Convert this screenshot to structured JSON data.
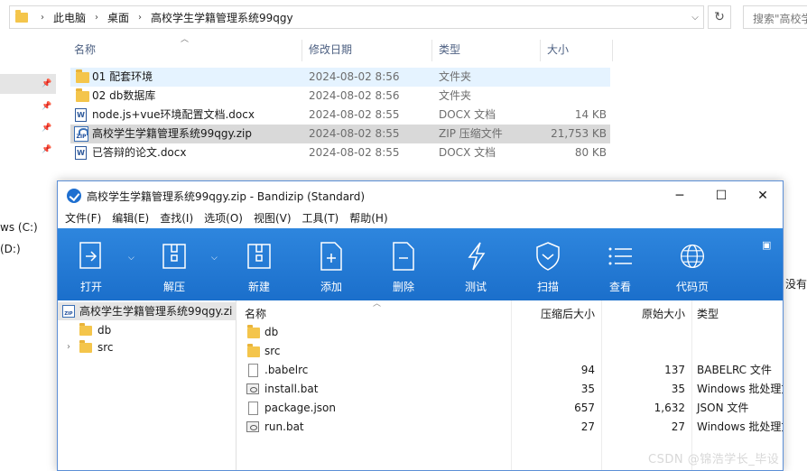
{
  "explorer": {
    "breadcrumb": [
      "此电脑",
      "桌面",
      "高校学生学籍管理系统99qgy"
    ],
    "search_placeholder": "搜索\"高校学",
    "columns": {
      "name": "名称",
      "modified": "修改日期",
      "type": "类型",
      "size": "大小"
    },
    "files": [
      {
        "name": "01  配套环境",
        "modified": "2024-08-02 8:56",
        "type": "文件夹",
        "size": "",
        "kind": "folder"
      },
      {
        "name": "02 db数据库",
        "modified": "2024-08-02 8:56",
        "type": "文件夹",
        "size": "",
        "kind": "folder"
      },
      {
        "name": "node.js+vue环境配置文档.docx",
        "modified": "2024-08-02 8:55",
        "type": "DOCX 文档",
        "size": "14 KB",
        "kind": "docx"
      },
      {
        "name": "高校学生学籍管理系统99qgy.zip",
        "modified": "2024-08-02 8:55",
        "type": "ZIP 压缩文件",
        "size": "21,753 KB",
        "kind": "zip"
      },
      {
        "name": "已答辩的论文.docx",
        "modified": "2024-08-02 8:55",
        "type": "DOCX 文档",
        "size": "80 KB",
        "kind": "docx"
      }
    ],
    "drives": [
      "ws (C:)",
      "(D:)"
    ],
    "edge_text": "没有"
  },
  "bandizip": {
    "title": "高校学生学籍管理系统99qgy.zip - Bandizip (Standard)",
    "menu": [
      "文件(F)",
      "编辑(E)",
      "查找(I)",
      "选项(O)",
      "视图(V)",
      "工具(T)",
      "帮助(H)"
    ],
    "toolbar": [
      {
        "label": "打开",
        "icon": "open-icon"
      },
      {
        "label": "解压",
        "icon": "extract-icon"
      },
      {
        "label": "新建",
        "icon": "new-archive-icon"
      },
      {
        "label": "添加",
        "icon": "add-file-icon"
      },
      {
        "label": "删除",
        "icon": "delete-file-icon"
      },
      {
        "label": "测试",
        "icon": "test-icon"
      },
      {
        "label": "扫描",
        "icon": "shield-scan-icon"
      },
      {
        "label": "查看",
        "icon": "view-list-icon"
      },
      {
        "label": "代码页",
        "icon": "globe-icon"
      }
    ],
    "tree": {
      "root": "高校学生学籍管理系统99qgy.zi",
      "children": [
        "db",
        "src"
      ]
    },
    "list": {
      "columns": {
        "name": "名称",
        "compressed": "压缩后大小",
        "original": "原始大小",
        "type": "类型"
      },
      "rows": [
        {
          "name": "db",
          "compressed": "",
          "original": "",
          "type": "",
          "kind": "folder"
        },
        {
          "name": "src",
          "compressed": "",
          "original": "",
          "type": "",
          "kind": "folder"
        },
        {
          "name": ".babelrc",
          "compressed": "94",
          "original": "137",
          "type": "BABELRC 文件",
          "kind": "file"
        },
        {
          "name": "install.bat",
          "compressed": "35",
          "original": "35",
          "type": "Windows 批处理文",
          "kind": "bat"
        },
        {
          "name": "package.json",
          "compressed": "657",
          "original": "1,632",
          "type": "JSON 文件",
          "kind": "file"
        },
        {
          "name": "run.bat",
          "compressed": "27",
          "original": "27",
          "type": "Windows 批处理文",
          "kind": "bat"
        }
      ]
    }
  },
  "watermark": "CSDN @锦浩学长_毕设",
  "colors": {
    "toolbar": "#1b6fcb",
    "hover_row": "#e5f3ff",
    "selected_row": "#d9d9d9"
  }
}
